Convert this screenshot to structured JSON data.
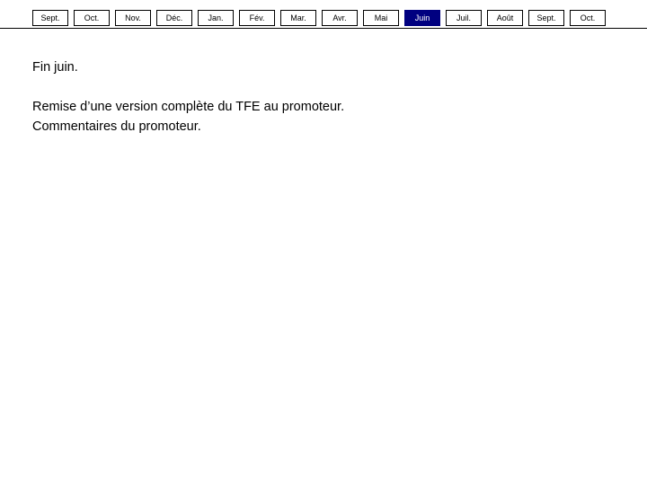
{
  "nav": {
    "name": "month-timeline",
    "tabs": [
      {
        "label": "Sept.",
        "active": false
      },
      {
        "label": "Oct.",
        "active": false
      },
      {
        "label": "Nov.",
        "active": false
      },
      {
        "label": "Déc.",
        "active": false
      },
      {
        "label": "Jan.",
        "active": false
      },
      {
        "label": "Fév.",
        "active": false
      },
      {
        "label": "Mar.",
        "active": false
      },
      {
        "label": "Avr.",
        "active": false
      },
      {
        "label": "Mai",
        "active": false
      },
      {
        "label": "Juin",
        "active": true
      },
      {
        "label": "Juil.",
        "active": false
      },
      {
        "label": "Août",
        "active": false
      },
      {
        "label": "Sept.",
        "active": false
      },
      {
        "label": "Oct.",
        "active": false
      }
    ],
    "active_label": "Juin",
    "active_bg_color": "#000080",
    "active_text_color": "#ffffff",
    "tab_bg_color": "#ffffff",
    "tab_border_color": "#000000",
    "rule_color": "#000000"
  },
  "content": {
    "lead": "Fin juin.",
    "detail": "Remise d’une version complète du TFE au promoteur.\nCommentaires du promoteur."
  }
}
